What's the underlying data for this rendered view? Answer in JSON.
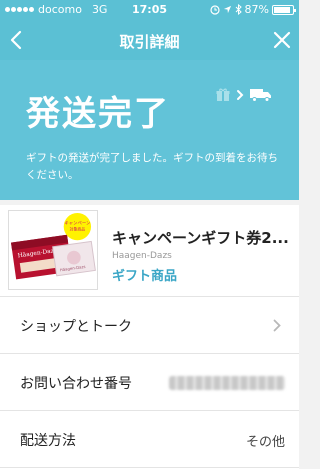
{
  "status_bar": {
    "carrier": "docomo",
    "network": "3G",
    "time": "17:05",
    "battery": "87%",
    "battery_level": 0.87
  },
  "nav": {
    "title": "取引詳細",
    "back_icon": "chevron-left-icon",
    "close_icon": "close-icon"
  },
  "hero": {
    "title": "発送完了",
    "message": "ギフトの発送が完了しました。ギフトの到着をお待ちください。",
    "icons": [
      "gift-icon",
      "chevron-right-icon",
      "truck-icon"
    ]
  },
  "product": {
    "name": "キャンペーンギフト券2...",
    "brand": "Haagen-Dazs",
    "category": "ギフト商品",
    "image_badge": "キャンペーン 対象商品"
  },
  "rows": {
    "shop_talk": {
      "label": "ショップとトーク"
    },
    "inquiry": {
      "label": "お問い合わせ番号"
    },
    "shipping": {
      "label": "配送方法",
      "value": "その他"
    }
  },
  "colors": {
    "header": "#5bc0d4",
    "hero": "#62c3d8",
    "accent": "#3aa6c6"
  }
}
